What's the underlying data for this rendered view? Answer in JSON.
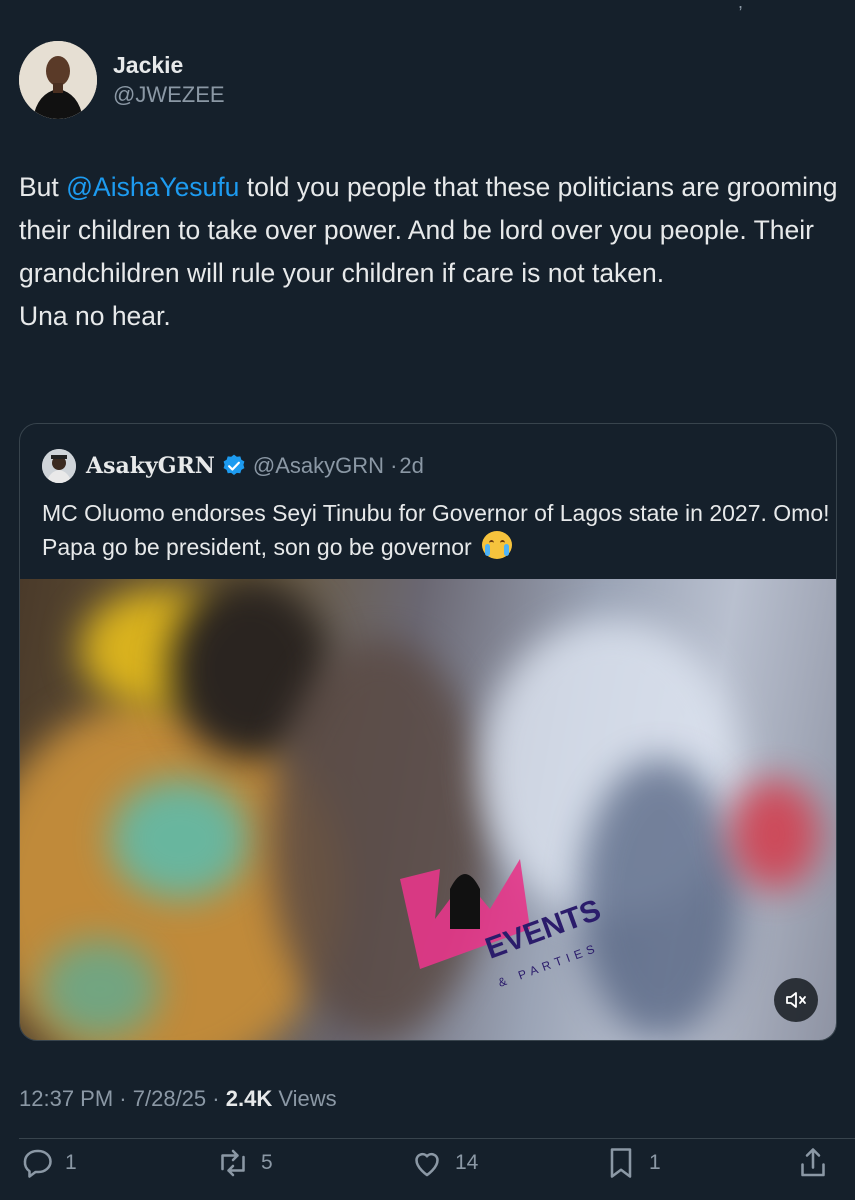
{
  "author": {
    "display_name": "Jackie",
    "handle": "@JWEZEE"
  },
  "tweet": {
    "text_before": "But ",
    "mention": "@AishaYesufu",
    "text_line1_rest": " told you people that these politicians are grooming their children to take over power. And be lord over you people. Their grandchildren will rule your children if care is not taken.",
    "text_line2": "Una no hear."
  },
  "quoted": {
    "display_name": "AsakyGRN",
    "handle": "@AsakyGRN",
    "time": "2d",
    "text": "MC Oluomo endorses Seyi Tinubu for Governor of Lagos state in 2027. Omo! Papa go be president, son go be governor",
    "emoji": "loudly-crying-face",
    "media_watermark": "EVENTS",
    "media_watermark_sub": "& PARTIES"
  },
  "meta": {
    "time": "12:37 PM",
    "date": "7/28/25",
    "views_count": "2.4K",
    "views_label": "Views"
  },
  "actions": {
    "reply_count": "1",
    "retweet_count": "5",
    "like_count": "14",
    "bookmark_count": "1"
  },
  "colors": {
    "background": "#15202b",
    "accent": "#1d9bf0",
    "secondary_text": "#8b98a5",
    "border": "#38444d"
  }
}
